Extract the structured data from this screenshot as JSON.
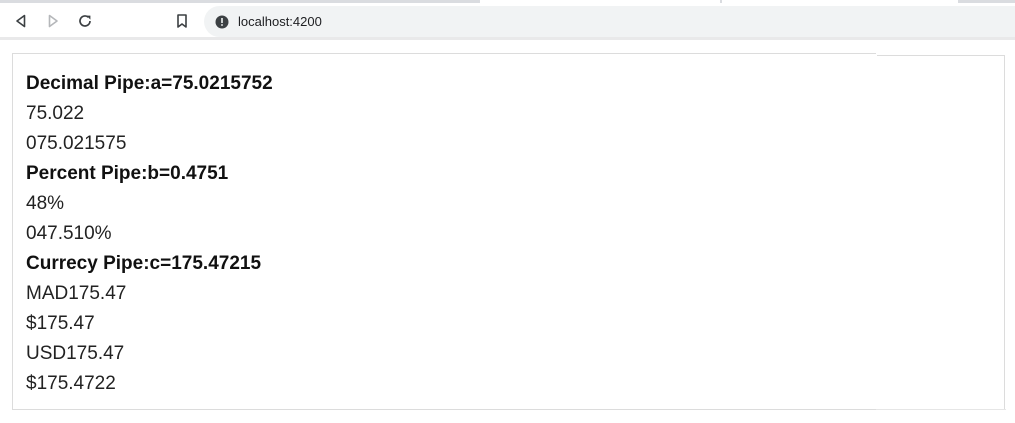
{
  "browser": {
    "url": "localhost:4200",
    "icons": {
      "back": "back-arrow-icon",
      "forward": "forward-arrow-icon",
      "reload": "reload-icon",
      "bookmark": "bookmark-icon",
      "info": "info-icon"
    }
  },
  "page": {
    "decimal": {
      "heading": "Decimal Pipe:a=75.0215752",
      "values": [
        "75.022",
        "075.021575"
      ]
    },
    "percent": {
      "heading": "Percent Pipe:b=0.4751",
      "values": [
        "48%",
        "047.510%"
      ]
    },
    "currency": {
      "heading": "Currecy Pipe:c=175.47215",
      "values": [
        "MAD175.47",
        "$175.47",
        "USD175.47",
        "$175.4722"
      ]
    }
  }
}
